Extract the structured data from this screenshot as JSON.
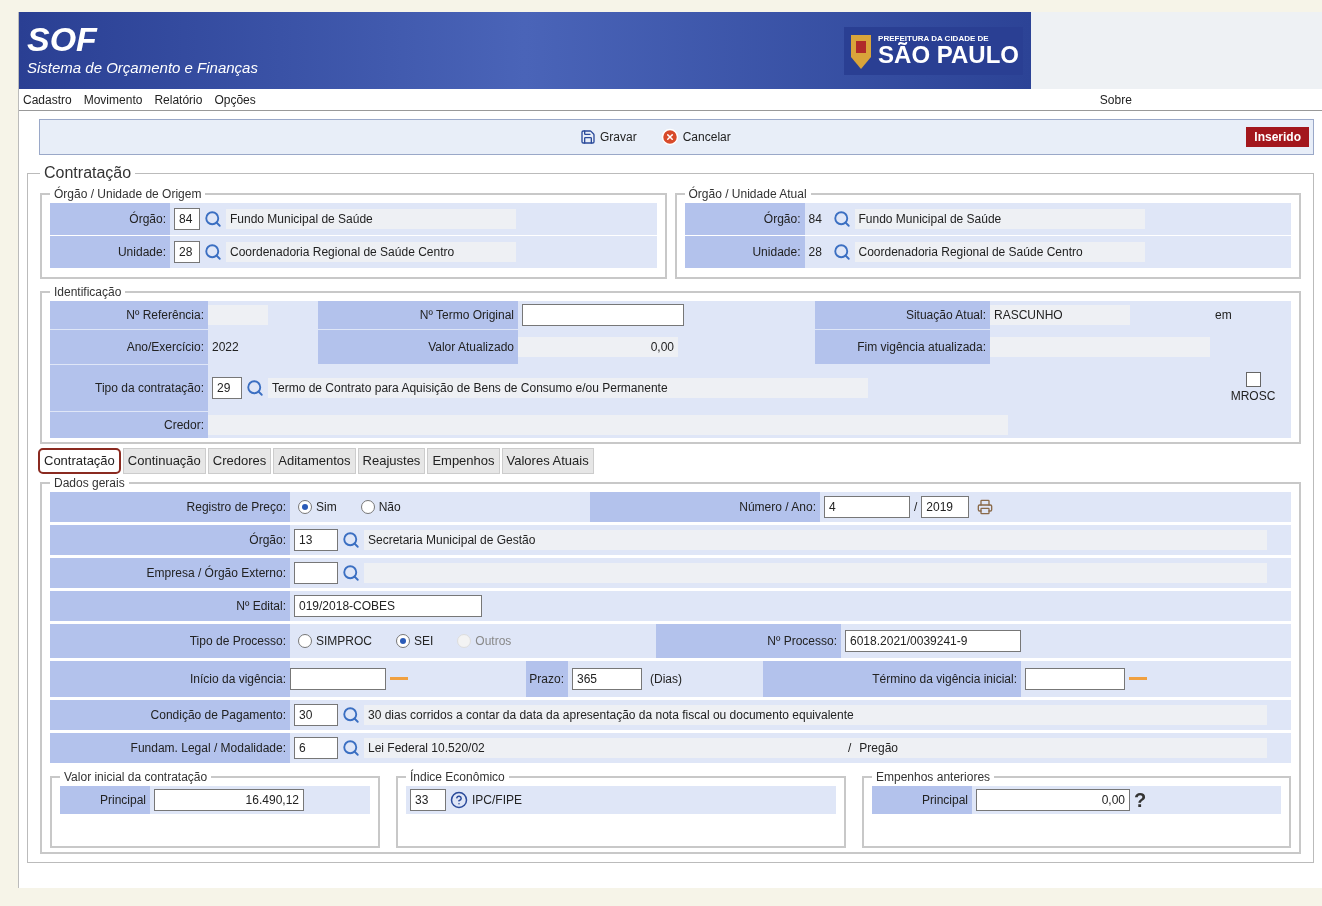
{
  "header": {
    "title": "SOF",
    "subtitle": "Sistema de Orçamento e Finanças",
    "logo_top": "PREFEITURA DA CIDADE DE",
    "logo_city": "SÃO PAULO"
  },
  "menu": {
    "items": [
      "Cadastro",
      "Movimento",
      "Relatório",
      "Opções"
    ],
    "right": "Sobre"
  },
  "toolbar": {
    "buttons": [
      {
        "label": "Gravar",
        "kind": "save"
      },
      {
        "label": "Cancelar",
        "kind": "cancel"
      }
    ],
    "status": "Inserido"
  },
  "section_title": "Contratação",
  "origem": {
    "legend": "Órgão / Unidade de Origem",
    "rows": [
      {
        "label": "Órgão:",
        "code": "84",
        "name": "Fundo Municipal de Saúde"
      },
      {
        "label": "Unidade:",
        "code": "28",
        "name": "Coordenadoria Regional de Saúde Centro"
      }
    ]
  },
  "atual": {
    "legend": "Órgão / Unidade Atual",
    "rows": [
      {
        "label": "Órgão:",
        "code": "84",
        "name": "Fundo Municipal de Saúde"
      },
      {
        "label": "Unidade:",
        "code": "28",
        "name": "Coordenadoria Regional de Saúde Centro"
      }
    ]
  },
  "identificacao": {
    "legend": "Identificação",
    "referencia_label": "Nº Referência:",
    "termo_label": "Nº Termo Original",
    "situacao_label": "Situação Atual:",
    "situacao_value": "RASCUNHO",
    "situacao_extra": "em",
    "ano_label": "Ano/Exercício:",
    "ano_value": "2022",
    "valor_label": "Valor Atualizado",
    "valor_value": "0,00",
    "fim_label": "Fim vigência atualizada:",
    "tipo_label": "Tipo da contratação:",
    "tipo_code": "29",
    "tipo_name": "Termo de Contrato para Aquisição de Bens de Consumo e/ou Permanente",
    "mrosc_label": "MROSC",
    "mrosc_checked": false,
    "credor_label": "Credor:"
  },
  "tabs": [
    {
      "label": "Contratação",
      "selected": true,
      "highlighted": true
    },
    {
      "label": "Continuação",
      "selected": false,
      "highlighted": false
    },
    {
      "label": "Credores",
      "selected": false,
      "highlighted": false
    },
    {
      "label": "Aditamentos",
      "selected": false,
      "highlighted": false
    },
    {
      "label": "Reajustes",
      "selected": false,
      "highlighted": false
    },
    {
      "label": "Empenhos",
      "selected": false,
      "highlighted": false
    },
    {
      "label": "Valores Atuais",
      "selected": false,
      "highlighted": false
    }
  ],
  "dados_gerais": {
    "legend": "Dados gerais",
    "registro": {
      "label": "Registro de Preço:",
      "options": [
        {
          "label": "Sim",
          "selected": true,
          "disabled": false
        },
        {
          "label": "Não",
          "selected": false,
          "disabled": false
        }
      ]
    },
    "numero_label": "Número / Ano:",
    "numero": "4",
    "numero_sep": "/",
    "ano": "2019",
    "orgao": {
      "label": "Órgão:",
      "code": "13",
      "name": "Secretaria Municipal de Gestão"
    },
    "empresa": {
      "label": "Empresa / Órgão Externo:"
    },
    "edital": {
      "label": "Nº Edital:",
      "value": "019/2018-COBES"
    },
    "tipo_processo": {
      "label": "Tipo de Processo:",
      "options": [
        {
          "label": "SIMPROC",
          "selected": false,
          "disabled": false
        },
        {
          "label": "SEI",
          "selected": true,
          "disabled": false
        },
        {
          "label": "Outros",
          "selected": false,
          "disabled": true
        }
      ]
    },
    "processo_label": "Nº Processo:",
    "processo": "6018.2021/0039241-9",
    "inicio_label": "Início da vigência:",
    "prazo_label": "Prazo:",
    "prazo": "365",
    "prazo_unit": "(Dias)",
    "termino_label": "Término da vigência inicial:",
    "pagamento": {
      "label": "Condição de Pagamento:",
      "code": "30",
      "name": "30 dias corridos a contar da data da apresentação da nota fiscal ou documento equivalente"
    },
    "fundam": {
      "label": "Fundam. Legal / Modalidade:",
      "code": "6",
      "name": "Lei Federal 10.520/02",
      "sep": "/",
      "modalidade": "Pregão"
    }
  },
  "valor_inicial": {
    "legend": "Valor inicial da contratação",
    "principal_label": "Principal",
    "principal": "16.490,12"
  },
  "indice": {
    "legend": "Índice Econômico",
    "code": "33",
    "name": "IPC/FIPE"
  },
  "empenhos": {
    "legend": "Empenhos anteriores",
    "principal_label": "Principal",
    "principal": "0,00",
    "help": "?"
  }
}
